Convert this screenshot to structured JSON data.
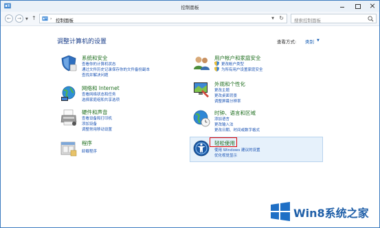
{
  "window": {
    "title": "控制面板"
  },
  "nav": {
    "address": "控制面板",
    "address_sep": "›",
    "search_placeholder": "搜索控制面板"
  },
  "main": {
    "heading": "调整计算机的设置",
    "view_by_label": "查看方式:",
    "view_by_value": "类别"
  },
  "categories": [
    {
      "id": "system-security",
      "title": "系统和安全",
      "icon": "shield-icon",
      "links": [
        "查看你的计算机状态",
        "通过文件历史记录保存你的文件备份副本",
        "查找并解决问题"
      ]
    },
    {
      "id": "network-internet",
      "title": "网络和 Internet",
      "icon": "network-globe-icon",
      "links": [
        "查看网络状态和任务",
        "选择家庭组和共享选项"
      ]
    },
    {
      "id": "hardware-sound",
      "title": "硬件和声音",
      "icon": "printer-icon",
      "links": [
        "查看设备和打印机",
        "添加设备",
        "调整常用移动设置"
      ]
    },
    {
      "id": "programs",
      "title": "程序",
      "icon": "programs-icon",
      "links": [
        "卸载程序"
      ]
    },
    {
      "id": "user-accounts",
      "title": "用户帐户和家庭安全",
      "icon": "users-icon",
      "links": [
        "更改帐户类型",
        "为所有用户设置家庭安全"
      ]
    },
    {
      "id": "appearance",
      "title": "外观和个性化",
      "icon": "appearance-icon",
      "links": [
        "更改主题",
        "更改桌面背景",
        "调整屏幕分辨率"
      ]
    },
    {
      "id": "clock-language-region",
      "title": "时钟、语言和区域",
      "icon": "clock-globe-icon",
      "links": [
        "添加语言",
        "更改输入法",
        "更改日期、时间或数字格式"
      ]
    },
    {
      "id": "ease-of-access",
      "title": "轻松使用",
      "icon": "ease-of-access-icon",
      "links": [
        "使用 Windows 建议的设置",
        "优化视觉显示"
      ]
    }
  ],
  "watermark": {
    "text": "Win8系统之家"
  },
  "colors": {
    "category_title": "#1d6d1d",
    "link": "#1a53b4",
    "heading": "#1a3e8a",
    "highlight": "#e6f1fb",
    "annotation_red": "#e00000"
  }
}
